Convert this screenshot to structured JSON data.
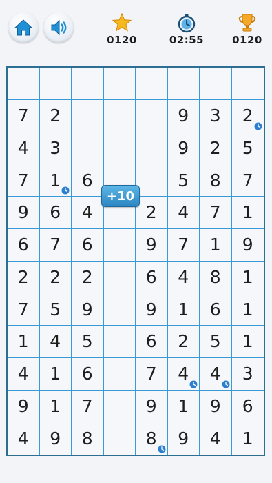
{
  "header": {
    "home_icon": "home-icon",
    "sound_icon": "speaker-icon",
    "stars": {
      "icon": "star-icon",
      "value": "0120"
    },
    "timer": {
      "icon": "stopwatch-icon",
      "value": "02:55"
    },
    "best": {
      "icon": "trophy-icon",
      "value": "0120"
    }
  },
  "bonus_badge": "+10",
  "board": {
    "columns": 8,
    "rows": [
      [
        "",
        "",
        "",
        "",
        "",
        "",
        "",
        ""
      ],
      [
        "7",
        "2",
        "",
        "",
        "",
        "9",
        "3",
        "2"
      ],
      [
        "4",
        "3",
        "",
        "",
        "",
        "9",
        "2",
        "5"
      ],
      [
        "7",
        "1",
        "6",
        "",
        "",
        "5",
        "8",
        "7"
      ],
      [
        "9",
        "6",
        "4",
        "",
        "2",
        "4",
        "7",
        "1"
      ],
      [
        "6",
        "7",
        "6",
        "",
        "9",
        "7",
        "1",
        "9"
      ],
      [
        "2",
        "2",
        "2",
        "",
        "6",
        "4",
        "8",
        "1"
      ],
      [
        "7",
        "5",
        "9",
        "",
        "9",
        "1",
        "6",
        "1"
      ],
      [
        "1",
        "4",
        "5",
        "",
        "6",
        "2",
        "5",
        "1"
      ],
      [
        "4",
        "1",
        "6",
        "",
        "7",
        "4",
        "4",
        "3"
      ],
      [
        "9",
        "1",
        "7",
        "",
        "9",
        "1",
        "9",
        "6"
      ],
      [
        "4",
        "9",
        "8",
        "",
        "8",
        "9",
        "4",
        "1"
      ]
    ],
    "timer_bonus_cells": [
      [
        1,
        7
      ],
      [
        3,
        1
      ],
      [
        9,
        5
      ],
      [
        9,
        6
      ],
      [
        11,
        4
      ]
    ]
  },
  "colors": {
    "grid_line": "#3a9ad6",
    "badge": "#2d86c2",
    "clock_badge": "#2a7fd0"
  }
}
